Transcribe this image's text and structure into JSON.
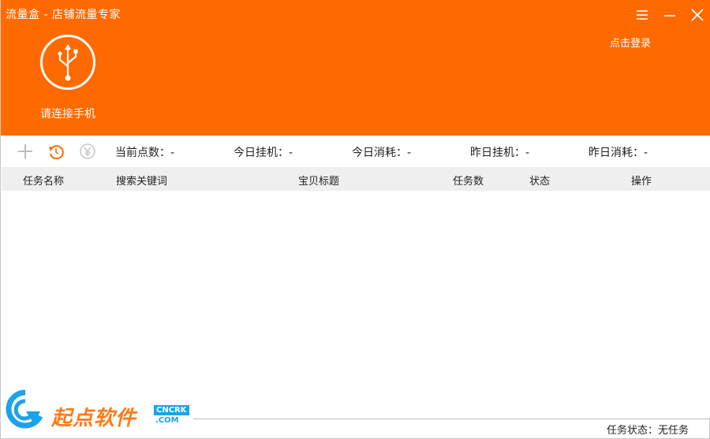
{
  "header": {
    "title": "流量盒 - 店铺流量专家",
    "login_link": "点击登录",
    "connect_label": "请连接手机",
    "color": "#ff6a00"
  },
  "toolbar": {
    "icons": [
      "add-icon",
      "refresh-icon",
      "yuan-icon"
    ],
    "stats": [
      {
        "label": "当前点数：-"
      },
      {
        "label": "今日挂机：-"
      },
      {
        "label": "今日消耗：-"
      },
      {
        "label": "昨日挂机：-"
      },
      {
        "label": "昨日消耗：-"
      }
    ]
  },
  "table": {
    "columns": [
      "任务名称",
      "搜索关键词",
      "宝贝标题",
      "任务数",
      "状态",
      "操作"
    ],
    "rows": []
  },
  "status_bar": {
    "text": "任务状态：无任务"
  },
  "watermark": {
    "brand": "起点软件",
    "badge": "CNCRK",
    "domain": ".COM"
  }
}
